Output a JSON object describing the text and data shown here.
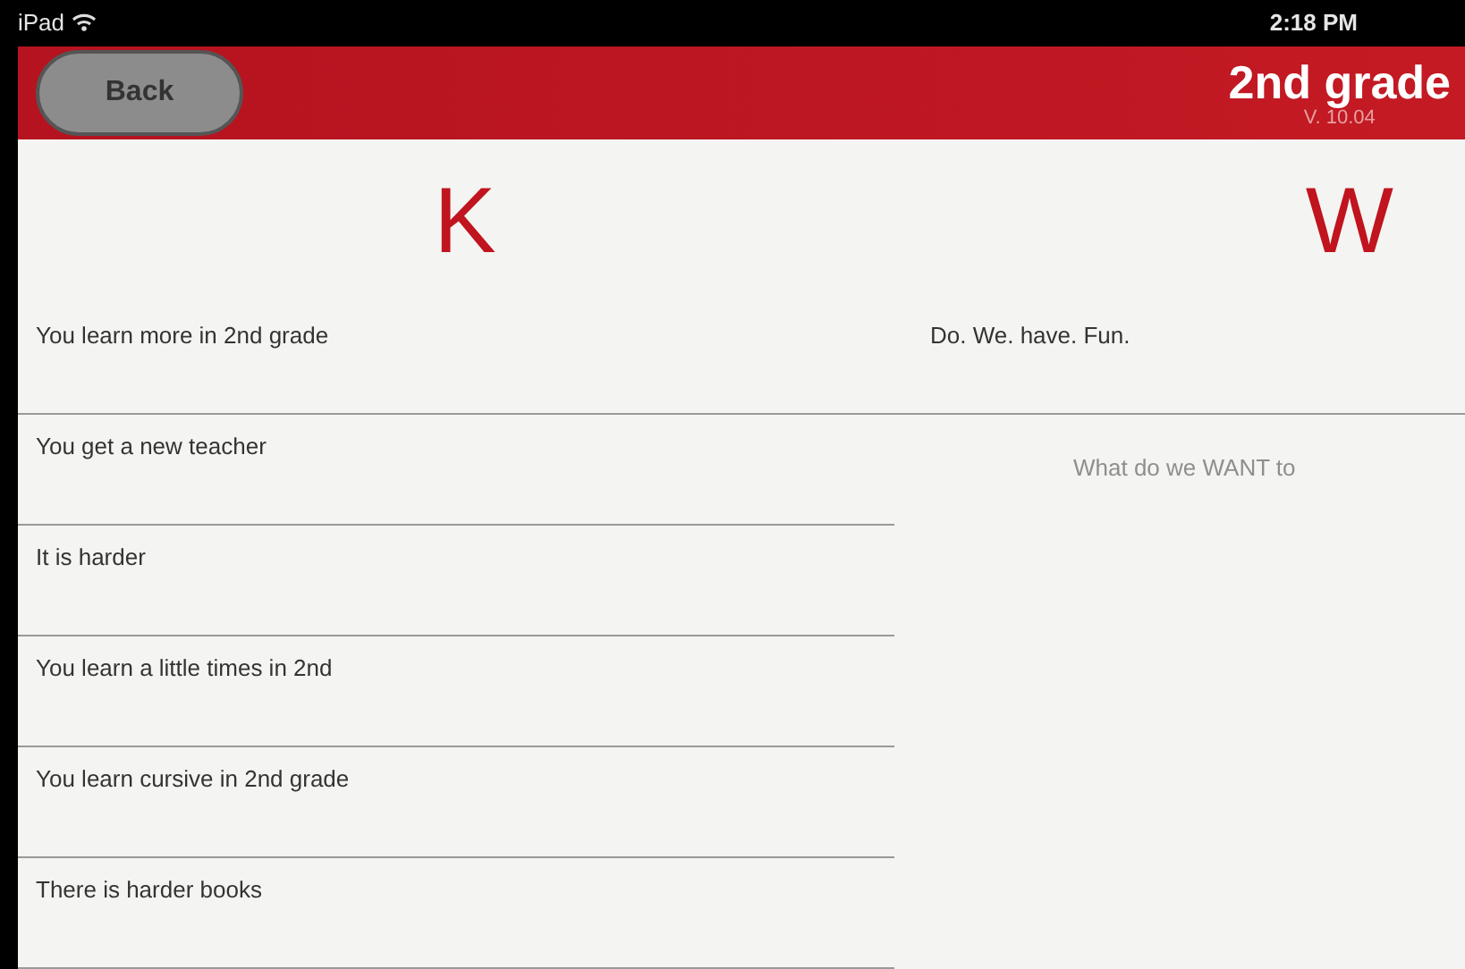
{
  "status_bar": {
    "device": "iPad",
    "time": "2:18 PM"
  },
  "header": {
    "back_button": "Back",
    "title": "2nd grade",
    "version": "V. 10.04"
  },
  "columns": [
    {
      "heading": "K",
      "items": [
        "You learn more in 2nd grade",
        "You get a new teacher",
        "It is harder",
        "You learn a little times in 2nd",
        "You learn cursive in 2nd grade",
        "There is harder books"
      ]
    },
    {
      "heading": "W",
      "items": [
        "Do. We. have. Fun."
      ],
      "placeholder": "What do we WANT to"
    }
  ]
}
